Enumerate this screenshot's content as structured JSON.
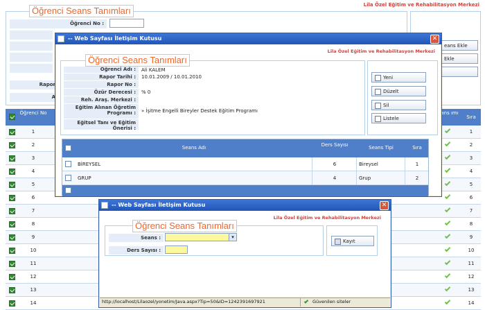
{
  "bg": {
    "center_name": "Lila Özel Eğitim ve Rehabilitasyon Merkezi",
    "legend": "Öğrenci Seans Tanımları",
    "ogrenci_no_label": "Öğrenci No :",
    "rapor_label": "Rapor",
    "a_label": "A",
    "side_buttons": [
      "eans Ekle",
      "Ekle"
    ],
    "grid_headers": {
      "no": "Öğrenci No",
      "ans": "ans ımı",
      "sira": "Sıra"
    },
    "rows": [
      "1",
      "2",
      "3",
      "4",
      "5",
      "6",
      "7",
      "8",
      "9",
      "10",
      "11",
      "12",
      "13",
      "14"
    ]
  },
  "win1": {
    "title": "-- Web Sayfası İletişim Kutusu",
    "center_name": "Lila Özel Eğitim ve Rehabilitasyon Merkezi",
    "legend": "Öğrenci Seans Tanımları",
    "fields": [
      {
        "label": "Öğrenci Adı :",
        "value": "Ali KALEM"
      },
      {
        "label": "Rapor Tarihi :",
        "value": "10.01.2009 / 10.01.2010"
      },
      {
        "label": "Rapor No :",
        "value": ""
      },
      {
        "label": "Özür Derecesi :",
        "value": "% 0"
      },
      {
        "label": "Reh. Araş. Merkezi :",
        "value": ""
      },
      {
        "label": "Eğitim Alınan Öğretim Programı :",
        "value": "» İşitme Engelli Bireyler Destek Eğitim Programı"
      },
      {
        "label": "Eğitsel Tanı ve Eğitim Önerisi :",
        "value": ""
      }
    ],
    "buttons": [
      "Yeni",
      "Düzelt",
      "Sil",
      "Listele"
    ],
    "grid": {
      "headers": {
        "seans_adi": "Seans Adı",
        "ders_sayisi": "Ders Sayısı",
        "seans_tipi": "Seans Tipi",
        "sira": "Sıra"
      },
      "rows": [
        {
          "seans_adi": "BİREYSEL",
          "ders_sayisi": "6",
          "seans_tipi": "Bireysel",
          "sira": "1"
        },
        {
          "seans_adi": "GRUP",
          "ders_sayisi": "4",
          "seans_tipi": "Grup",
          "sira": "2"
        }
      ]
    }
  },
  "win2": {
    "title": "-- Web Sayfası İletişim Kutusu",
    "center_name": "Lila Özel Eğitim ve Rehabilitasyon Merkezi",
    "legend": "Öğrenci Seans Tanımları",
    "seans_label": "Seans :",
    "seans_value": "",
    "ders_label": "Ders Sayısı :",
    "ders_value": "",
    "kayit_label": "Kayıt",
    "status_url": "http://localhost/Lilaozel/yonetim/Java.aspx?Tip=50&ID=1242391697921",
    "status_zone": "Güvenilen siteler"
  }
}
